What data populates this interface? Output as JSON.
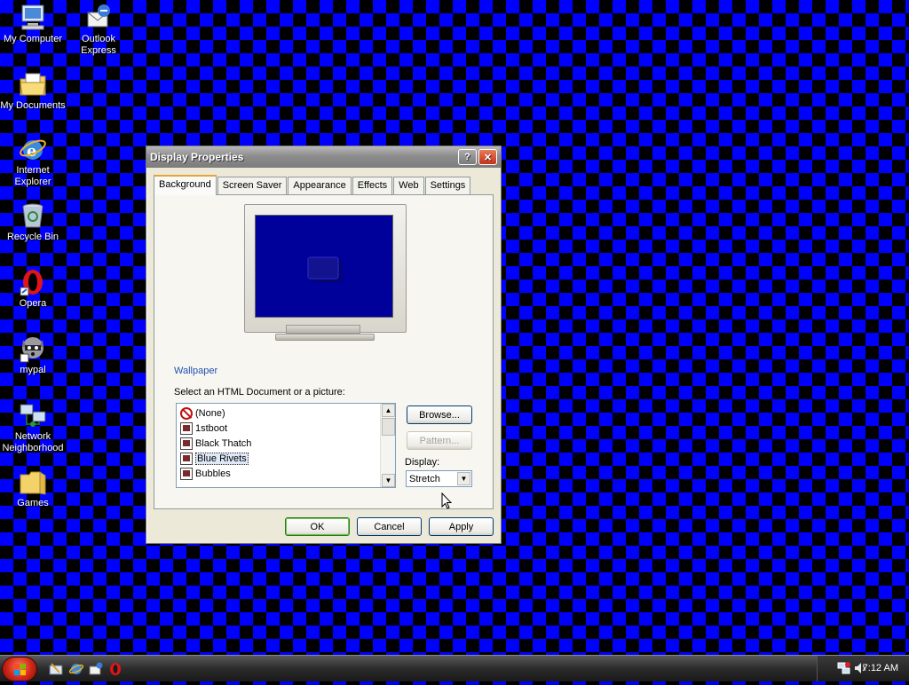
{
  "desktop": {
    "icons": [
      {
        "label": "My Computer"
      },
      {
        "label": "Outlook Express"
      },
      {
        "label": "My Documents"
      },
      {
        "label": "Internet Explorer"
      },
      {
        "label": "Recycle Bin"
      },
      {
        "label": "Opera"
      },
      {
        "label": "mypal"
      },
      {
        "label": "Network Neighborhood"
      },
      {
        "label": "Games"
      }
    ]
  },
  "dialog": {
    "title": "Display Properties",
    "help_glyph": "?",
    "close_glyph": "✕",
    "tabs": [
      "Background",
      "Screen Saver",
      "Appearance",
      "Effects",
      "Web",
      "Settings"
    ],
    "active_tab": "Background",
    "wallpaper_label": "Wallpaper",
    "select_label": "Select an HTML Document or a picture:",
    "wallpapers": [
      "(None)",
      "1stboot",
      "Black Thatch",
      "Blue Rivets",
      "Bubbles"
    ],
    "selected_wallpaper": "Blue Rivets",
    "browse_label": "Browse...",
    "pattern_label": "Pattern...",
    "display_label": "Display:",
    "display_value": "Stretch",
    "ok_label": "OK",
    "cancel_label": "Cancel",
    "apply_label": "Apply",
    "scroll_up_glyph": "▲",
    "scroll_down_glyph": "▼",
    "combo_arrow_glyph": "▼"
  },
  "taskbar": {
    "clock": "7:12 AM"
  },
  "colors": {
    "desktop_blue": "#0000ff",
    "desktop_black": "#000000",
    "accent_link": "#2150b4",
    "preview_screen": "#00009a"
  }
}
